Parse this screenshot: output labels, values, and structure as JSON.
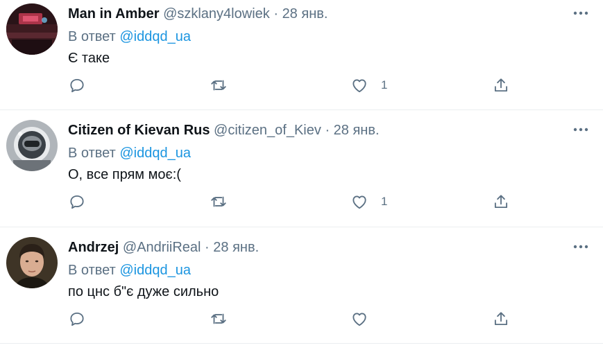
{
  "tweets": [
    {
      "name": "Man in Amber",
      "handle": "@szklany4lowiek",
      "separator": "·",
      "date": "28 янв.",
      "reply_prefix": "В ответ",
      "reply_to": "@iddqd_ua",
      "text": "Є таке",
      "likes": "1",
      "avatar_colors": {
        "bg": "#3a1a24",
        "accent": "#c23a52"
      }
    },
    {
      "name": "Citizen of Kievan Rus",
      "handle": "@citizen_of_Kiev",
      "separator": "·",
      "date": "28 янв.",
      "reply_prefix": "В ответ",
      "reply_to": "@iddqd_ua",
      "text": "О, все прям моє:(",
      "likes": "1",
      "avatar_colors": {
        "bg": "#9aa0a6",
        "accent": "#2b2f33"
      }
    },
    {
      "name": "Andrzej",
      "handle": "@AndriiReal",
      "separator": "·",
      "date": "28 янв.",
      "reply_prefix": "В ответ",
      "reply_to": "@iddqd_ua",
      "text": "по цнс б\"є дуже сильно",
      "likes": "",
      "avatar_colors": {
        "bg": "#4a3f2f",
        "accent": "#e0b8a0"
      }
    }
  ],
  "icons": {
    "reply": "reply-icon",
    "retweet": "retweet-icon",
    "like": "heart-icon",
    "share": "share-icon",
    "more": "more-icon"
  },
  "colors": {
    "text": "#0f1419",
    "secondary": "#5b7083",
    "link": "#1b95e0",
    "divider": "#ebeef0"
  }
}
